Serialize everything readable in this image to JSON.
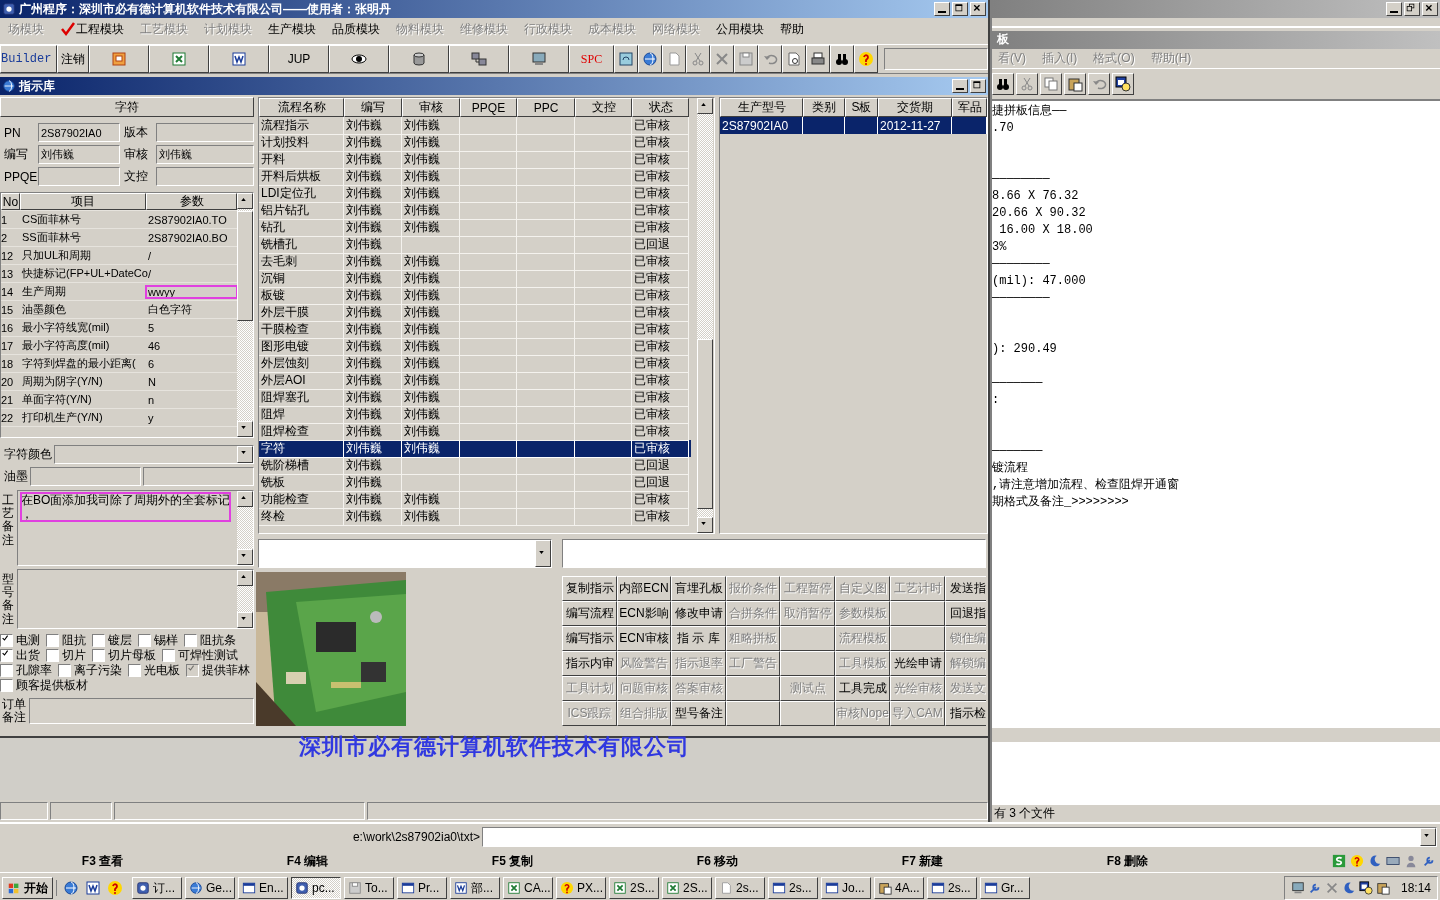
{
  "main_window": {
    "title": "广州程序：深圳市必有德计算机软件技术有限公司——使用者：张明丹",
    "menu": [
      {
        "label": "场模块",
        "disabled": true,
        "checked": false
      },
      {
        "label": "工程模块",
        "disabled": false,
        "checked": true
      },
      {
        "label": "工艺模块",
        "disabled": true,
        "checked": false
      },
      {
        "label": "计划模块",
        "disabled": true,
        "checked": false
      },
      {
        "label": "生产模块",
        "disabled": false,
        "checked": false
      },
      {
        "label": "品质模块",
        "disabled": false,
        "checked": false
      },
      {
        "label": "物料模块",
        "disabled": true,
        "checked": false
      },
      {
        "label": "维修模块",
        "disabled": true,
        "checked": false
      },
      {
        "label": "行政模块",
        "disabled": true,
        "checked": false
      },
      {
        "label": "成本模块",
        "disabled": true,
        "checked": false
      },
      {
        "label": "网络模块",
        "disabled": true,
        "checked": false
      },
      {
        "label": "公用模块",
        "disabled": false,
        "checked": false
      },
      {
        "label": "帮助",
        "disabled": false,
        "checked": false
      }
    ],
    "toolbar": [
      {
        "label": "Builder"
      },
      {
        "label": "注销"
      },
      {
        "label": "JUP"
      },
      {
        "label": "SPC"
      }
    ]
  },
  "child_window": {
    "title": "指示库"
  },
  "item_panel": {
    "header": "字符",
    "fields": [
      {
        "label": "PN",
        "value": "2S87902IA0"
      },
      {
        "label": "版本"
      },
      {
        "label": "编写",
        "value": "刘伟巍"
      },
      {
        "label": "审核",
        "value": "刘伟巍"
      },
      {
        "label": "PPQE"
      },
      {
        "label": "文控"
      }
    ],
    "param_table": {
      "columns": [
        "No",
        "项目",
        "参数"
      ],
      "rows": [
        {
          "no": "1",
          "item": "CS面菲林号",
          "value": "2S87902IA0.TO",
          "highlighted": false
        },
        {
          "no": "2",
          "item": "SS面菲林号",
          "value": "2S87902IA0.BO",
          "highlighted": false
        },
        {
          "no": "12",
          "item": "只加UL和周期",
          "value": "/",
          "highlighted": false
        },
        {
          "no": "13",
          "item": "快捷标记(FP+UL+DateCo",
          "value": "/",
          "highlighted": false
        },
        {
          "no": "14",
          "item": "生产周期",
          "value": "wwyy",
          "highlighted": true
        },
        {
          "no": "15",
          "item": "油墨颜色",
          "value": "白色字符",
          "highlighted": false
        },
        {
          "no": "16",
          "item": "最小字符线宽(mil)",
          "value": "5",
          "highlighted": false
        },
        {
          "no": "17",
          "item": "最小字符高度(mil)",
          "value": "46",
          "highlighted": false
        },
        {
          "no": "18",
          "item": "字符到焊盘的最小距离(",
          "value": "6",
          "highlighted": false
        },
        {
          "no": "20",
          "item": "周期为阴字(Y/N)",
          "value": "N",
          "highlighted": false
        },
        {
          "no": "21",
          "item": "单面字符(Y/N)",
          "value": "n",
          "highlighted": false
        },
        {
          "no": "22",
          "item": "打印机生产(Y/N)",
          "value": "y",
          "highlighted": false
        }
      ]
    },
    "color_label": "字符颜色",
    "ink_label": "油墨",
    "process_remark": {
      "label": "工艺备注",
      "lines": [
        "在BO面添加我司除了周期外的全套标记",
        "，"
      ],
      "highlighted": true
    },
    "model_remark": {
      "label": "型号备注"
    },
    "checkbox_rows": [
      [
        {
          "label": "电测",
          "checked": true,
          "disabled": false
        },
        {
          "label": "阻抗",
          "checked": false,
          "disabled": false
        },
        {
          "label": "镀层",
          "checked": false,
          "disabled": false
        },
        {
          "label": "锡样",
          "checked": false,
          "disabled": false
        },
        {
          "label": "阻抗条",
          "checked": false,
          "disabled": false
        }
      ],
      [
        {
          "label": "出货",
          "checked": true,
          "disabled": false
        },
        {
          "label": "切片",
          "checked": false,
          "disabled": false
        },
        {
          "label": "切片母板",
          "checked": false,
          "disabled": false
        },
        {
          "label": "可焊性测试",
          "checked": false,
          "disabled": false
        }
      ],
      [
        {
          "label": "孔隙率",
          "checked": false,
          "disabled": false
        },
        {
          "label": "离子污染",
          "checked": false,
          "disabled": false
        },
        {
          "label": "光电板",
          "checked": false,
          "disabled": false
        },
        {
          "label": "提供菲林",
          "checked": true,
          "disabled": true
        }
      ],
      [
        {
          "label": "顾客提供板材",
          "checked": false,
          "disabled": false
        }
      ]
    ],
    "order_remark": {
      "label": "订单备注"
    }
  },
  "flow_table": {
    "columns": [
      "流程名称",
      "编写",
      "审核",
      "PPQE",
      "PPC",
      "文控",
      "状态"
    ],
    "rows": [
      {
        "name": "流程指示",
        "writer": "刘伟巍",
        "reviewer": "刘伟巍",
        "status": "已审核",
        "selected": false
      },
      {
        "name": "计划投料",
        "writer": "刘伟巍",
        "reviewer": "刘伟巍",
        "status": "已审核",
        "selected": false
      },
      {
        "name": "开料",
        "writer": "刘伟巍",
        "reviewer": "刘伟巍",
        "status": "已审核",
        "selected": false
      },
      {
        "name": "开料后烘板",
        "writer": "刘伟巍",
        "reviewer": "刘伟巍",
        "status": "已审核",
        "selected": false
      },
      {
        "name": "LDI定位孔",
        "writer": "刘伟巍",
        "reviewer": "刘伟巍",
        "status": "已审核",
        "selected": false
      },
      {
        "name": "铝片钻孔",
        "writer": "刘伟巍",
        "reviewer": "刘伟巍",
        "status": "已审核",
        "selected": false
      },
      {
        "name": "钻孔",
        "writer": "刘伟巍",
        "reviewer": "刘伟巍",
        "status": "已审核",
        "selected": false
      },
      {
        "name": "铣槽孔",
        "writer": "刘伟巍",
        "status": "已回退",
        "selected": false
      },
      {
        "name": "去毛刺",
        "writer": "刘伟巍",
        "reviewer": "刘伟巍",
        "status": "已审核",
        "selected": false
      },
      {
        "name": "沉铜",
        "writer": "刘伟巍",
        "reviewer": "刘伟巍",
        "status": "已审核",
        "selected": false
      },
      {
        "name": "板镀",
        "writer": "刘伟巍",
        "reviewer": "刘伟巍",
        "status": "已审核",
        "selected": false
      },
      {
        "name": "外层干膜",
        "writer": "刘伟巍",
        "reviewer": "刘伟巍",
        "status": "已审核",
        "selected": false
      },
      {
        "name": "干膜检查",
        "writer": "刘伟巍",
        "reviewer": "刘伟巍",
        "status": "已审核",
        "selected": false
      },
      {
        "name": "图形电镀",
        "writer": "刘伟巍",
        "reviewer": "刘伟巍",
        "status": "已审核",
        "selected": false
      },
      {
        "name": "外层蚀刻",
        "writer": "刘伟巍",
        "reviewer": "刘伟巍",
        "status": "已审核",
        "selected": false
      },
      {
        "name": "外层AOI",
        "writer": "刘伟巍",
        "reviewer": "刘伟巍",
        "status": "已审核",
        "selected": false
      },
      {
        "name": "阻焊塞孔",
        "writer": "刘伟巍",
        "reviewer": "刘伟巍",
        "status": "已审核",
        "selected": false
      },
      {
        "name": "阻焊",
        "writer": "刘伟巍",
        "reviewer": "刘伟巍",
        "status": "已审核",
        "selected": false
      },
      {
        "name": "阻焊检查",
        "writer": "刘伟巍",
        "reviewer": "刘伟巍",
        "status": "已审核",
        "selected": false
      },
      {
        "name": "字符",
        "writer": "刘伟巍",
        "reviewer": "刘伟巍",
        "status": "已审核",
        "selected": true
      },
      {
        "name": "铣阶梯槽",
        "writer": "刘伟巍",
        "status": "已回退",
        "selected": false
      },
      {
        "name": "铣板",
        "writer": "刘伟巍",
        "status": "已回退",
        "selected": false
      },
      {
        "name": "功能检查",
        "writer": "刘伟巍",
        "reviewer": "刘伟巍",
        "status": "已审核",
        "selected": false
      },
      {
        "name": "终检",
        "writer": "刘伟巍",
        "reviewer": "刘伟巍",
        "status": "已审核",
        "selected": false
      }
    ]
  },
  "model_table": {
    "columns": [
      "生产型号",
      "类别",
      "S板",
      "交货期",
      "军品"
    ],
    "rows": [
      {
        "model": "2S87902IA0",
        "delivery": "2012-11-27",
        "selected": true
      }
    ]
  },
  "action_buttons": [
    [
      {
        "label": "复制指示",
        "disabled": false
      },
      {
        "label": "内部ECN",
        "disabled": false
      },
      {
        "label": "盲埋孔板",
        "disabled": false
      },
      {
        "label": "报价条件",
        "disabled": true
      },
      {
        "label": "工程暂停",
        "disabled": true
      },
      {
        "label": "自定义图",
        "disabled": true
      },
      {
        "label": "工艺计时",
        "disabled": true
      },
      {
        "label": "发送指",
        "disabled": false
      }
    ],
    [
      {
        "label": "编写流程",
        "disabled": false
      },
      {
        "label": "ECN影响",
        "disabled": false
      },
      {
        "label": "修改申请",
        "disabled": false
      },
      {
        "label": "合拼条件",
        "disabled": true
      },
      {
        "label": "取消暂停",
        "disabled": true
      },
      {
        "label": "参数模板",
        "disabled": true
      },
      {
        "kind": "blank"
      },
      {
        "label": "回退指",
        "disabled": false
      }
    ],
    [
      {
        "label": "编写指示",
        "disabled": false
      },
      {
        "label": "ECN审核",
        "disabled": false
      },
      {
        "label": "指 示 库",
        "disabled": false
      },
      {
        "label": "粗略拼板",
        "disabled": true
      },
      {
        "kind": "blank"
      },
      {
        "label": "流程模板",
        "disabled": true
      },
      {
        "kind": "blank"
      },
      {
        "label": "锁住编",
        "disabled": true
      }
    ],
    [
      {
        "label": "指示内审",
        "disabled": false
      },
      {
        "label": "风险警告",
        "disabled": true
      },
      {
        "label": "指示退率",
        "disabled": true
      },
      {
        "label": "工厂警告",
        "disabled": true
      },
      {
        "kind": "blank"
      },
      {
        "label": "工具模板",
        "disabled": true
      },
      {
        "label": "光绘申请",
        "disabled": false
      },
      {
        "label": "解锁编",
        "disabled": true
      }
    ],
    [
      {
        "label": "工具计划",
        "disabled": true
      },
      {
        "label": "问题审核",
        "disabled": true
      },
      {
        "label": "答案审核",
        "disabled": true
      },
      {
        "kind": "blank"
      },
      {
        "label": "测试点",
        "disabled": true
      },
      {
        "label": "工具完成",
        "disabled": false
      },
      {
        "label": "光绘审核",
        "disabled": true
      },
      {
        "label": "发送文",
        "disabled": true
      }
    ],
    [
      {
        "label": "ICS跟踪",
        "disabled": true
      },
      {
        "label": "组合排版",
        "disabled": true
      },
      {
        "label": "型号备注",
        "disabled": false
      },
      {
        "kind": "blank"
      },
      {
        "kind": "blank"
      },
      {
        "label": "审核Nope",
        "disabled": true
      },
      {
        "label": "导入CAM",
        "disabled": true
      },
      {
        "label": "指示检",
        "disabled": false
      }
    ]
  ],
  "background_logo": "深圳市必有德计算机软件技术有限公司",
  "notepad": {
    "title": "板",
    "menu": [
      "看(V)",
      "插入(I)",
      "格式(O)",
      "帮助(H)"
    ],
    "lines": [
      {
        "kind": "text",
        "text": "捷拼板信息——"
      },
      {
        "kind": "text",
        "text": ".70"
      },
      {
        "kind": "blank"
      },
      {
        "kind": "blank"
      },
      {
        "kind": "text",
        "text": "————————"
      },
      {
        "kind": "text",
        "text": "8.66 X 76.32"
      },
      {
        "kind": "text",
        "text": "20.66 X 90.32"
      },
      {
        "kind": "text",
        "text": " 16.00 X 18.00"
      },
      {
        "kind": "text",
        "text": "3%"
      },
      {
        "kind": "text",
        "text": "————————"
      },
      {
        "kind": "text",
        "text": "(mil): 47.000"
      },
      {
        "kind": "text",
        "text": "————————"
      },
      {
        "kind": "blank"
      },
      {
        "kind": "blank"
      },
      {
        "kind": "text",
        "text": "): 290.49"
      },
      {
        "kind": "blank"
      },
      {
        "kind": "text",
        "text": "———————"
      },
      {
        "kind": "text",
        "text": ":"
      },
      {
        "kind": "blank"
      },
      {
        "kind": "blank"
      },
      {
        "kind": "text",
        "text": "———————"
      },
      {
        "kind": "text",
        "text": "镀流程"
      },
      {
        "kind": "text",
        "text": ",请注意增加流程、检查阻焊开通窗"
      },
      {
        "kind": "text",
        "text": "期格式及备注_>>>>>>>>"
      }
    ]
  },
  "file_manager": {
    "status": "有 3 个文件",
    "path": "e:\\work\\2s87902ia0\\txt>",
    "function_keys": [
      "F3 查看",
      "F4 编辑",
      "F5 复制",
      "F6 移动",
      "F7 新建",
      "F8 删除"
    ]
  },
  "taskbar": {
    "start": "开始",
    "tasks": [
      {
        "label": "订...",
        "selected": false
      },
      {
        "label": "Ge...",
        "selected": false
      },
      {
        "label": "En...",
        "selected": false
      },
      {
        "label": "pc...",
        "selected": true
      },
      {
        "label": "To...",
        "selected": false
      },
      {
        "label": "Pr...",
        "selected": false
      },
      {
        "label": "部...",
        "selected": false
      },
      {
        "label": "CA...",
        "selected": false
      },
      {
        "label": "PX...",
        "selected": false
      },
      {
        "label": "2S...",
        "selected": false
      },
      {
        "label": "2S...",
        "selected": false
      },
      {
        "label": "2s...",
        "selected": false
      },
      {
        "label": "2s...",
        "selected": false
      },
      {
        "label": "Jo...",
        "selected": false
      },
      {
        "label": "4A...",
        "selected": false
      },
      {
        "label": "2s...",
        "selected": false
      },
      {
        "label": "Gr...",
        "selected": false
      }
    ],
    "clock": "18:14"
  }
}
